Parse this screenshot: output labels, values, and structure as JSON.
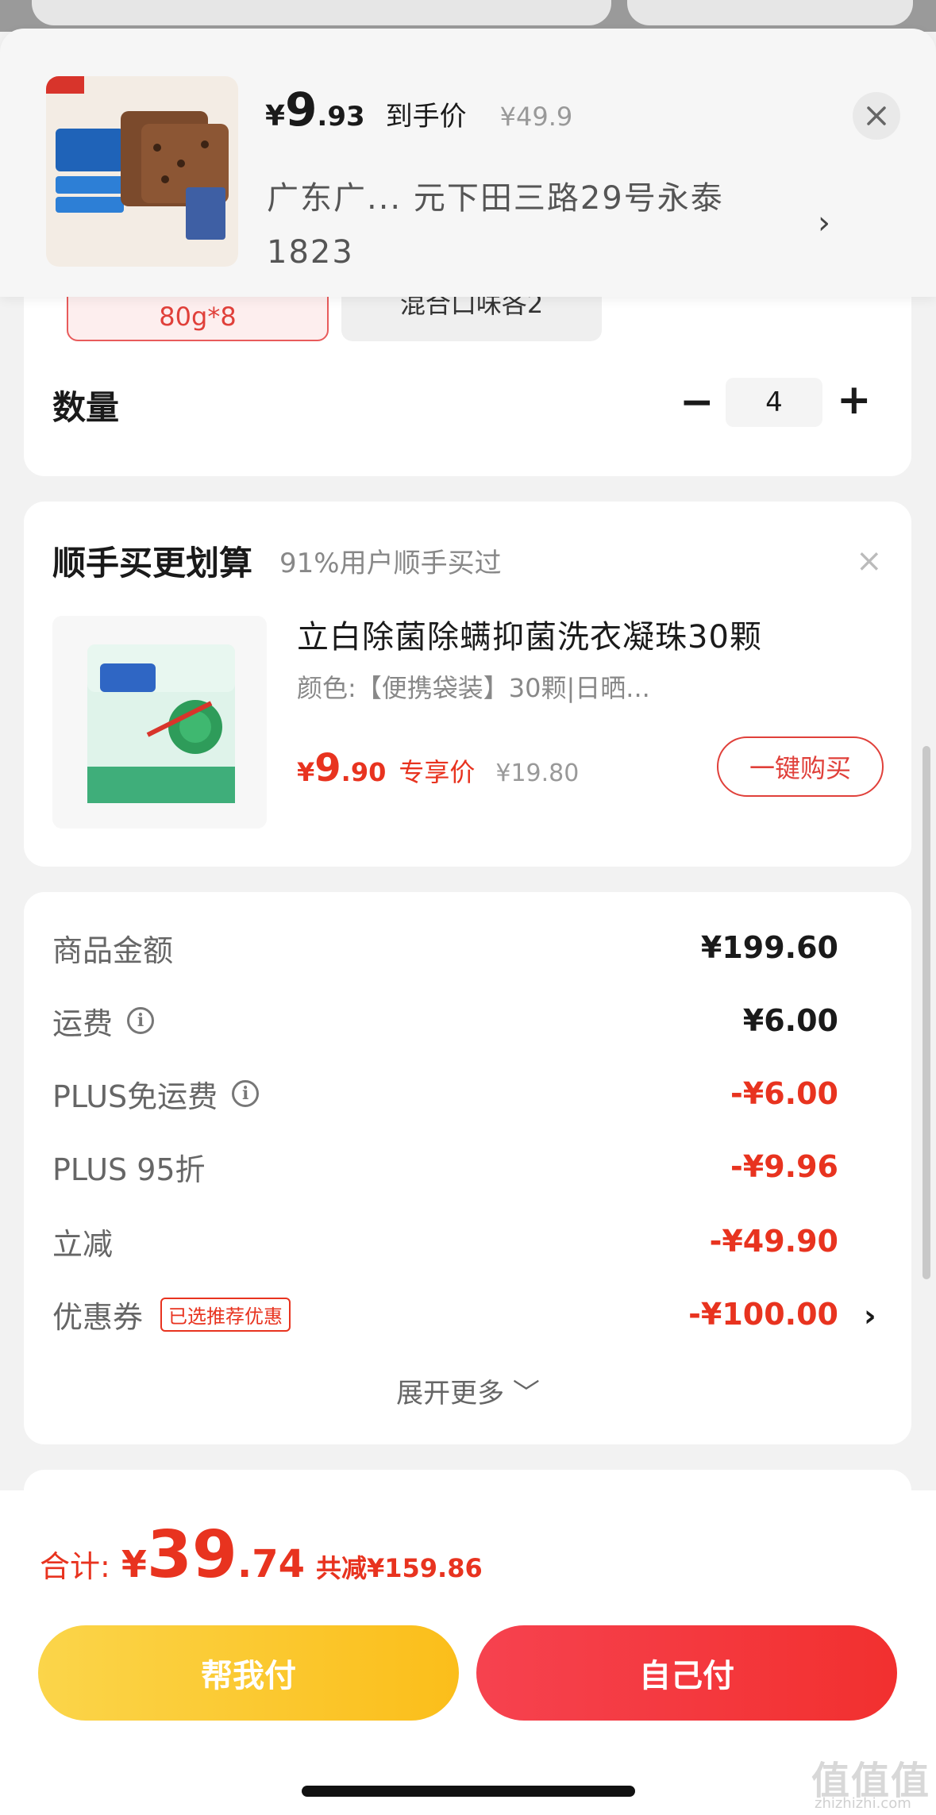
{
  "header": {
    "price_symbol": "¥",
    "price_int": "9",
    "price_dec": ".93",
    "price_label": "到手价",
    "original_price": "¥49.9",
    "address": "广东广...  元下田三路29号永泰1823",
    "close_icon": "close-icon",
    "address_chevron": "›"
  },
  "spec": {
    "selected_chip": "80g*8",
    "other_chip": "混合口味各2"
  },
  "quantity": {
    "label": "数量",
    "minus": "−",
    "value": "4",
    "plus": "+"
  },
  "upsell": {
    "title": "顺手买更划算",
    "subtitle": "91%用户顺手买过",
    "close": "×",
    "product_name": "立白除菌除螨抑菌洗衣凝珠30颗",
    "product_spec": "颜色:【便携袋装】30颗|日晒...",
    "price_symbol": "¥",
    "price_int": "9",
    "price_dec": ".90",
    "price_label": "专享价",
    "original_price": "¥19.80",
    "buy_button": "一键购买"
  },
  "summary": {
    "rows": [
      {
        "label": "商品金额",
        "value": "¥199.60"
      },
      {
        "label": "运费",
        "value": "¥6.00"
      },
      {
        "label": "PLUS免运费",
        "value": "-¥6.00"
      },
      {
        "label": "PLUS 95折",
        "value": "-¥9.96"
      },
      {
        "label": "立减",
        "value": "-¥49.90"
      },
      {
        "label": "优惠券",
        "tag": "已选推荐优惠",
        "value": "-¥100.00"
      }
    ],
    "expand": "展开更多 ﹀",
    "coupon_chevron": "›"
  },
  "bottom": {
    "total_label": "合计:",
    "total_symbol": "¥",
    "total_int": "39",
    "total_dec": ".74",
    "total_saving": "共减¥159.86",
    "help_pay": "帮我付",
    "self_pay": "自己付"
  },
  "watermark": {
    "main": "值值值",
    "sub": "zhizhizhi.com"
  },
  "colors": {
    "accent_red": "#e8331f",
    "yellow_button": "#fbc72a",
    "red_button": "#f2382f"
  }
}
